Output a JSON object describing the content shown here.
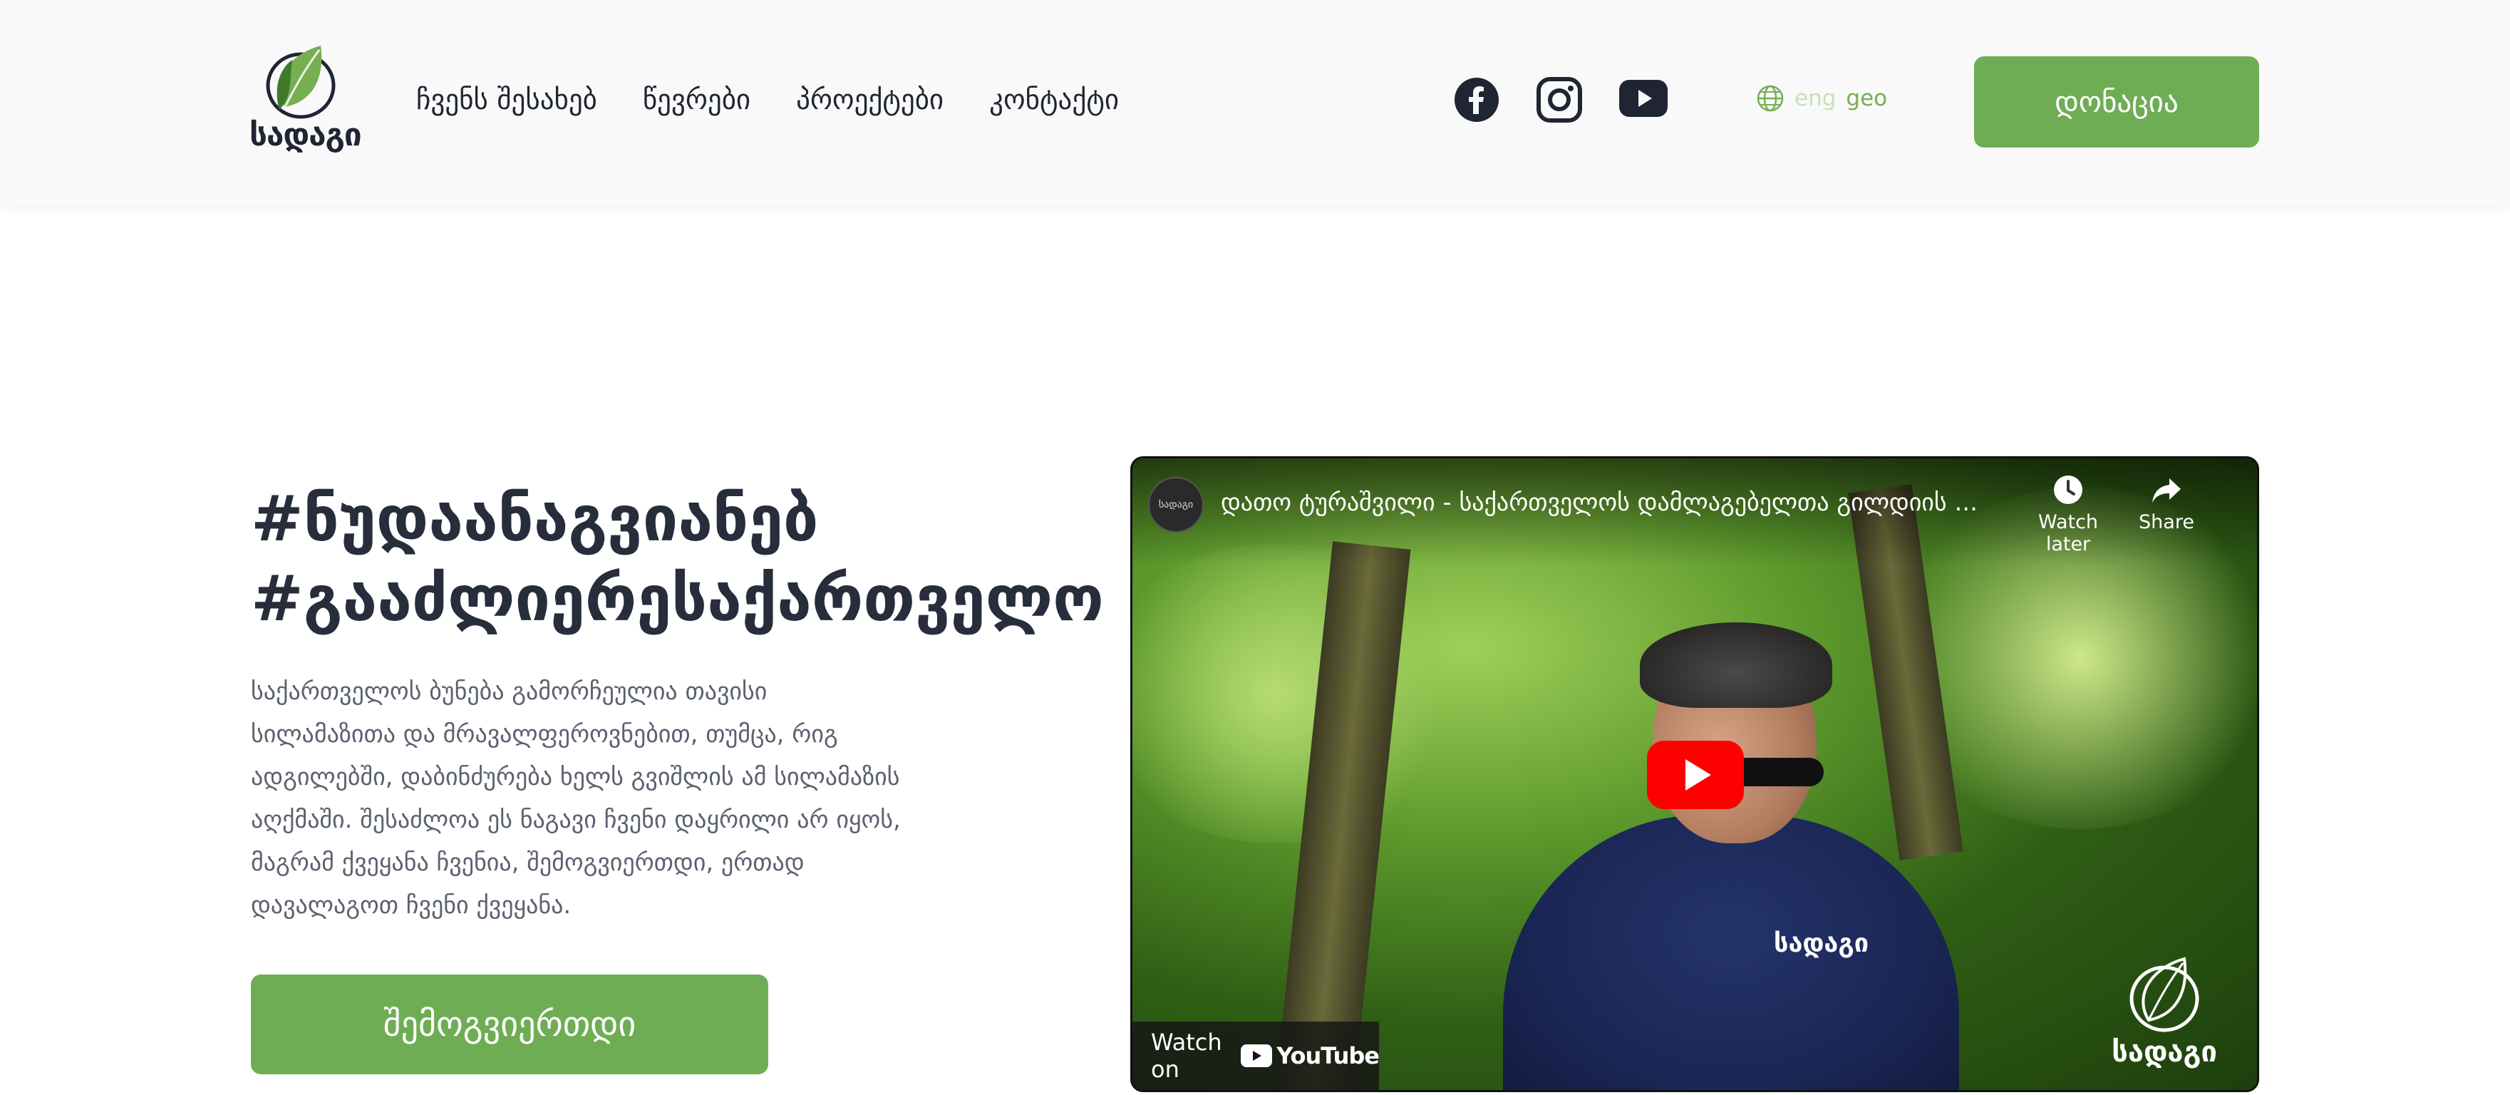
{
  "header": {
    "logo_text": "სადაგი",
    "nav": [
      {
        "label": "ჩვენს შესახებ"
      },
      {
        "label": "წევრები"
      },
      {
        "label": "პროექტები"
      },
      {
        "label": "კონტაქტი"
      }
    ],
    "social_icons": [
      "facebook-icon",
      "instagram-icon",
      "youtube-icon"
    ],
    "lang": {
      "eng": "eng",
      "geo": "geo",
      "active": "geo"
    },
    "donate_label": "დონაცია"
  },
  "hero": {
    "title_line1": "#ნუდაანაგვიანებ",
    "title_line2": "#გააძლიერესაქართველო",
    "description": "საქართველოს ბუნება გამორჩეულია თავისი სილამაზითა და მრავალფეროვნებით, თუმცა, რიგ ადგილებში, დაბინძურება ხელს გვიშლის ამ სილამაზის აღქმაში. შესაძლოა ეს ნაგავი ჩვენი დაყრილი არ იყოს, მაგრამ ქვეყანა ჩვენია, შემოგვიერთდი, ერთად დავალაგოთ ჩვენი ქვეყანა.",
    "cta_label": "შემოგვიერთდი"
  },
  "video": {
    "channel_avatar": "სადაგი",
    "title": "დათო ტურაშვილი - საქართველოს დამლაგებელთა გილდიის ...",
    "watch_later": "Watch later",
    "share": "Share",
    "watch_on": "Watch on",
    "youtube_brand": "YouTube",
    "shirt_text": "სადაგი",
    "watermark_text": "სადაგი"
  },
  "colors": {
    "accent_green": "#6fad55",
    "text_dark": "#1f2532",
    "text_muted": "#5b6170",
    "lang_inactive": "#c9e0b5",
    "lang_active": "#76ae52",
    "youtube_red": "#ff0000"
  }
}
